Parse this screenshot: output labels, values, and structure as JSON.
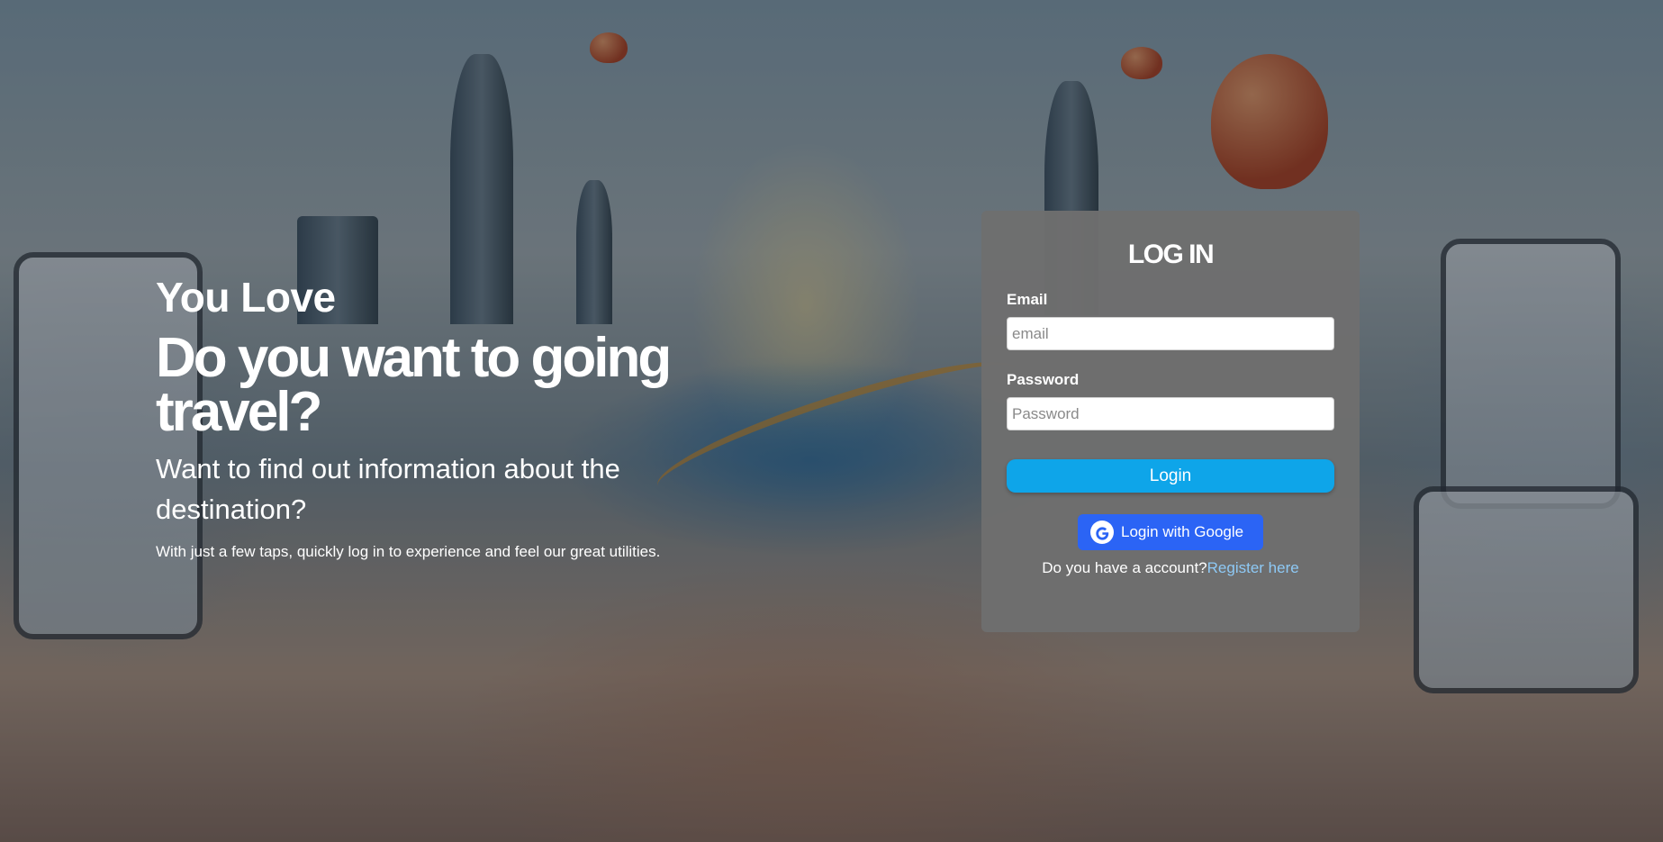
{
  "hero": {
    "eyebrow": "You Love",
    "title": "Do you want to going travel?",
    "subtitle": "Want to find out information about the destination?",
    "note": "With just a few taps, quickly log in to experience and feel our great utilities."
  },
  "login": {
    "title": "LOG IN",
    "email_label": "Email",
    "email_placeholder": "email",
    "email_value": "",
    "password_label": "Password",
    "password_placeholder": "Password",
    "password_value": "",
    "login_button": "Login",
    "google_button": "Login with Google",
    "google_icon": "google-icon",
    "account_prompt": "Do you have a account?",
    "register_link": "Register here"
  },
  "colors": {
    "login_button": "#0ea5e9",
    "google_button": "#2b64f5",
    "register_link": "#8ec9f5",
    "card_background": "#6e6e6e"
  }
}
